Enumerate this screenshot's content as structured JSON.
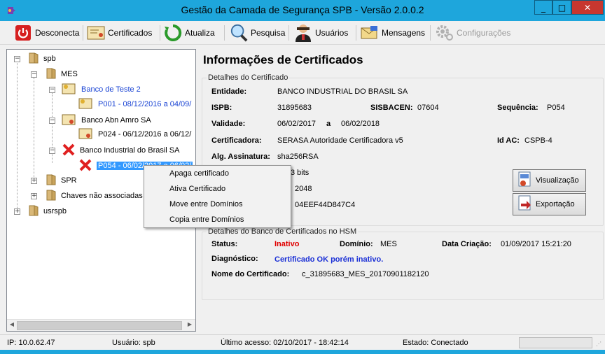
{
  "window": {
    "title": "Gestão da Camada de Segurança SPB - Versão 2.0.0.2",
    "minimize_glyph": "_",
    "maximize_glyph": "□",
    "close_glyph": "✕"
  },
  "toolbar": {
    "disconnect": "Desconecta",
    "certificates": "Certificados",
    "refresh": "Atualiza",
    "search": "Pesquisa",
    "users": "Usuários",
    "messages": "Mensagens",
    "settings": "Configurações"
  },
  "tree": {
    "root_spb": "spb",
    "mes": "MES",
    "banco_teste": "Banco de Teste 2",
    "banco_teste_cert": "P001 - 08/12/2016 a 04/09/",
    "abn": "Banco Abn Amro SA",
    "abn_cert": "P024 - 06/12/2016 a 06/12/",
    "industrial": "Banco Industrial do Brasil SA",
    "industrial_cert": "P054 - 06/02/2017 a 06/02/",
    "spr": "SPR",
    "chaves": "Chaves não associadas",
    "usrspb": "usrspb"
  },
  "context_menu": {
    "items": [
      "Apaga certificado",
      "Ativa Certificado",
      "Move entre Domínios",
      "Copia entre Domínios"
    ]
  },
  "info": {
    "title": "Informações de Certificados",
    "details_group": "Detalhes do Certificado",
    "entidade_label": "Entidade:",
    "entidade_value": "BANCO INDUSTRIAL DO BRASIL SA",
    "ispb_label": "ISPB:",
    "ispb_value": "31895683",
    "sisbacen_label": "SISBACEN:",
    "sisbacen_value": "07604",
    "sequencia_label": "Sequência:",
    "sequencia_value": "P054",
    "validade_label": "Validade:",
    "validade_from": "06/02/2017",
    "validade_sep": "a",
    "validade_to": "06/02/2018",
    "certificadora_label": "Certificadora:",
    "certificadora_value": "SERASA Autoridade Certificadora v5",
    "idac_label": "Id AC:",
    "idac_value": "CSPB-4",
    "alg_label": "Alg. Assinatura:",
    "alg_value": "sha256RSA",
    "bits_partial": "3 bits",
    "exponent_partial": "2048",
    "serial_partial": "04EEF44D847C4",
    "btn_view": "Visualização",
    "btn_export": "Exportação",
    "hsm_group": "Detalhes do Banco de Certificados no HSM",
    "status_label": "Status:",
    "status_value": "Inativo",
    "dominio_label": "Domínio:",
    "dominio_value": "MES",
    "criacao_label": "Data Criação:",
    "criacao_value": "01/09/2017 15:21:20",
    "diagnostico_label": "Diagnóstico:",
    "diagnostico_value": "Certificado OK porém inativo.",
    "nome_label": "Nome do Certificado:",
    "nome_value": "c_31895683_MES_20170901182120"
  },
  "status_bar": {
    "ip": "IP: 10.0.62.47",
    "user": "Usuário: spb",
    "last_access": "Último acesso: 02/10/2017 - 18:42:14",
    "state": "Estado: Conectado"
  },
  "colors": {
    "titlebar": "#1ea6dc",
    "close": "#c7372f",
    "selection": "#3399ff",
    "link_blue": "#1a44d4",
    "status_red": "#e00000"
  }
}
